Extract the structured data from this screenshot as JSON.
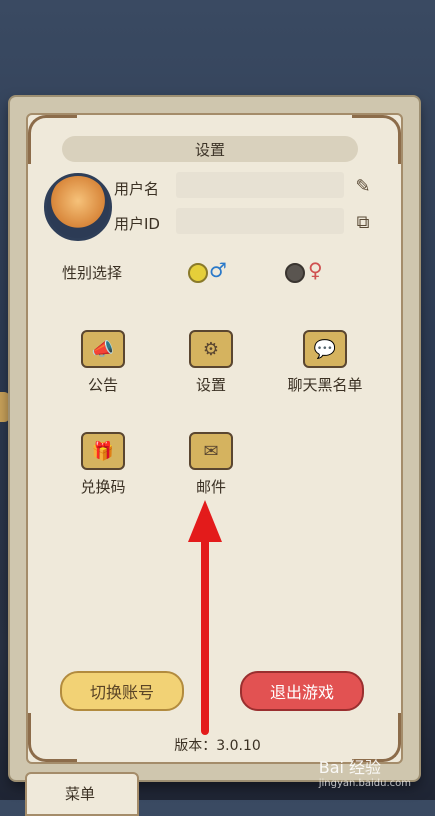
{
  "title": "设置",
  "profile": {
    "username_label": "用户名",
    "userid_label": "用户ID",
    "edit_icon": "pencil-icon",
    "copy_icon": "copy-icon"
  },
  "gender": {
    "label": "性别选择",
    "male_symbol": "♂",
    "female_symbol": "♀",
    "male_selected": true
  },
  "grid": {
    "notice": "公告",
    "settings": "设置",
    "chat_blacklist": "聊天黑名单",
    "redeem_code": "兑换码",
    "mail": "邮件"
  },
  "buttons": {
    "switch_account": "切换账号",
    "exit_game": "退出游戏"
  },
  "version": "版本：3.0.10",
  "bottom_menu": "菜单",
  "watermark": {
    "main": "Bai 经验",
    "sub": "jingyan.baidu.com"
  },
  "colors": {
    "panel_bg": "#efe9da",
    "gold_button": "#f2d275",
    "red_button": "#e25252",
    "annotation_arrow": "#e31b1b"
  }
}
